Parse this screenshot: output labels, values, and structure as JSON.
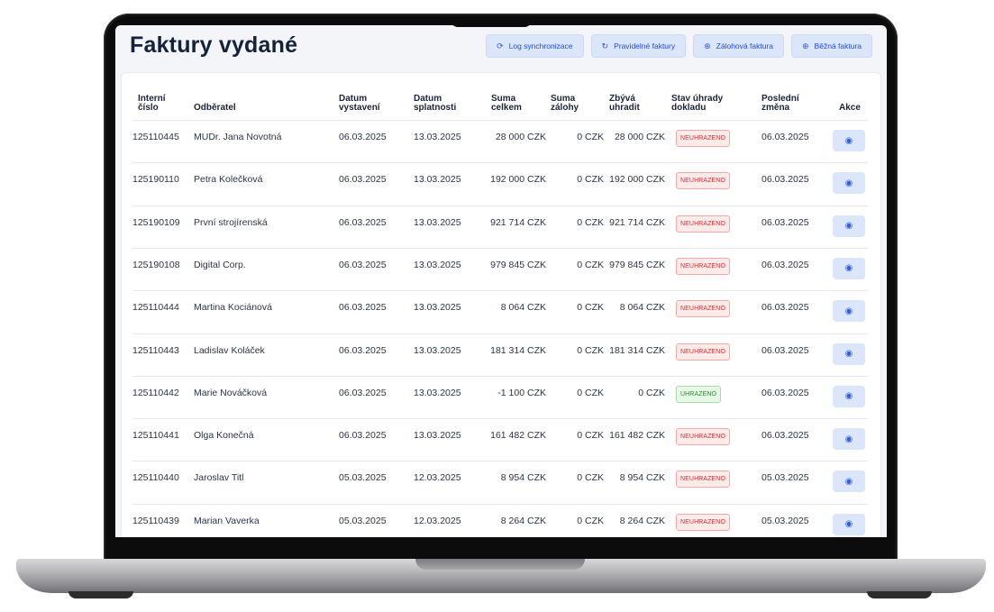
{
  "page": {
    "title": "Faktury vydané"
  },
  "toolbar": {
    "buttons": [
      {
        "label": "Log synchronizace",
        "icon": "sync-icon"
      },
      {
        "label": "Pravidelné faktury",
        "icon": "refresh-icon"
      },
      {
        "label": "Zálohová faktura",
        "icon": "plus-circle-icon"
      },
      {
        "label": "Běžná faktura",
        "icon": "plus-circle-icon"
      }
    ]
  },
  "table": {
    "headers": {
      "internal_number": [
        "Interní",
        "číslo"
      ],
      "customer": [
        "Odběratel"
      ],
      "issue_date": [
        "Datum",
        "vystavení"
      ],
      "due_date": [
        "Datum",
        "splatnosti"
      ],
      "total": [
        "Suma",
        "celkem"
      ],
      "advance": [
        "Suma",
        "zálohy"
      ],
      "remaining": [
        "Zbývá",
        "uhradit"
      ],
      "payment_status": [
        "Stav úhrady",
        "dokladu"
      ],
      "last_change": [
        "Poslední",
        "změna"
      ],
      "actions": [
        "Akce"
      ]
    },
    "rows": [
      {
        "number": "125110445",
        "customer": "MUDr. Jana Novotná",
        "issued": "06.03.2025",
        "due": "13.03.2025",
        "total": "28 000 CZK",
        "advance": "0 CZK",
        "remaining": "28 000 CZK",
        "status": "NEUHRAZENO",
        "status_type": "unpaid",
        "changed": "06.03.2025"
      },
      {
        "number": "125190110",
        "customer": "Petra Kolečková",
        "issued": "06.03.2025",
        "due": "13.03.2025",
        "total": "192 000 CZK",
        "advance": "0 CZK",
        "remaining": "192 000 CZK",
        "status": "NEUHRAZENO",
        "status_type": "unpaid",
        "changed": "06.03.2025"
      },
      {
        "number": "125190109",
        "customer": "První strojírenská",
        "issued": "06.03.2025",
        "due": "13.03.2025",
        "total": "921 714 CZK",
        "advance": "0 CZK",
        "remaining": "921 714 CZK",
        "status": "NEUHRAZENO",
        "status_type": "unpaid",
        "changed": "06.03.2025"
      },
      {
        "number": "125190108",
        "customer": "Digital Corp.",
        "issued": "06.03.2025",
        "due": "13.03.2025",
        "total": "979 845 CZK",
        "advance": "0 CZK",
        "remaining": "979 845 CZK",
        "status": "NEUHRAZENO",
        "status_type": "unpaid",
        "changed": "06.03.2025"
      },
      {
        "number": "125110444",
        "customer": "Martina Kociánová",
        "issued": "06.03.2025",
        "due": "13.03.2025",
        "total": "8 064 CZK",
        "advance": "0 CZK",
        "remaining": "8 064 CZK",
        "status": "NEUHRAZENO",
        "status_type": "unpaid",
        "changed": "06.03.2025"
      },
      {
        "number": "125110443",
        "customer": "Ladislav Koláček",
        "issued": "06.03.2025",
        "due": "13.03.2025",
        "total": "181 314 CZK",
        "advance": "0 CZK",
        "remaining": "181 314 CZK",
        "status": "NEUHRAZENO",
        "status_type": "unpaid",
        "changed": "06.03.2025"
      },
      {
        "number": "125110442",
        "customer": "Marie Nováčková",
        "issued": "06.03.2025",
        "due": "13.03.2025",
        "total": "-1 100 CZK",
        "advance": "0 CZK",
        "remaining": "0 CZK",
        "status": "UHRAZENO",
        "status_type": "paid",
        "changed": "06.03.2025"
      },
      {
        "number": "125110441",
        "customer": "Olga Konečná",
        "issued": "06.03.2025",
        "due": "13.03.2025",
        "total": "161 482 CZK",
        "advance": "0 CZK",
        "remaining": "161 482 CZK",
        "status": "NEUHRAZENO",
        "status_type": "unpaid",
        "changed": "06.03.2025"
      },
      {
        "number": "125110440",
        "customer": "Jaroslav Titl",
        "issued": "05.03.2025",
        "due": "12.03.2025",
        "total": "8 954 CZK",
        "advance": "0 CZK",
        "remaining": "8 954 CZK",
        "status": "NEUHRAZENO",
        "status_type": "unpaid",
        "changed": "05.03.2025"
      },
      {
        "number": "125110439",
        "customer": "Marian Vaverka",
        "issued": "05.03.2025",
        "due": "12.03.2025",
        "total": "8 264 CZK",
        "advance": "0 CZK",
        "remaining": "8 264 CZK",
        "status": "NEUHRAZENO",
        "status_type": "unpaid",
        "changed": "05.03.2025"
      }
    ]
  },
  "colors": {
    "accent": "#1d4ed8",
    "button_bg": "#dbe6fb",
    "unpaid": "#d62f2f",
    "paid": "#2f8a2f"
  }
}
